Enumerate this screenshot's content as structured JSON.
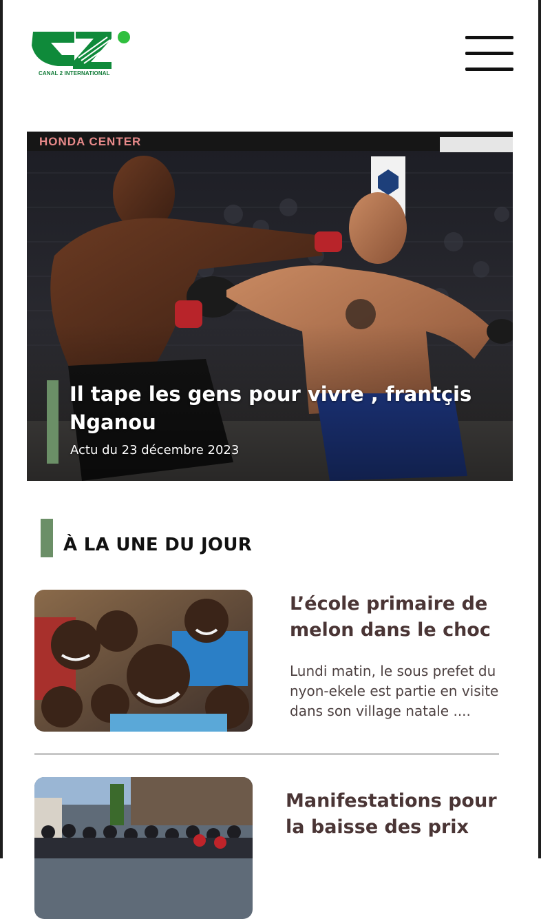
{
  "header": {
    "logo_text": "CANAL 2 INTERNATIONAL",
    "brand_color": "#0f8a3a"
  },
  "menu": {
    "icon": "hamburger-menu-icon"
  },
  "hero": {
    "title": "Il tape les gens pour vivre , frantçis Nganou",
    "date": "Actu du 23 décembre 2023",
    "image_signage": "HONDA CENTER",
    "accent_color": "#6b8f67"
  },
  "section": {
    "title": "À LA UNE DU JOUR"
  },
  "articles": [
    {
      "title": "L’école primaire de melon dans le choc",
      "description": "Lundi matin, le sous prefet du nyon-ekele est partie en visite dans son village natale ...."
    },
    {
      "title": "Manifestations pour la baisse des prix",
      "description": ""
    }
  ]
}
